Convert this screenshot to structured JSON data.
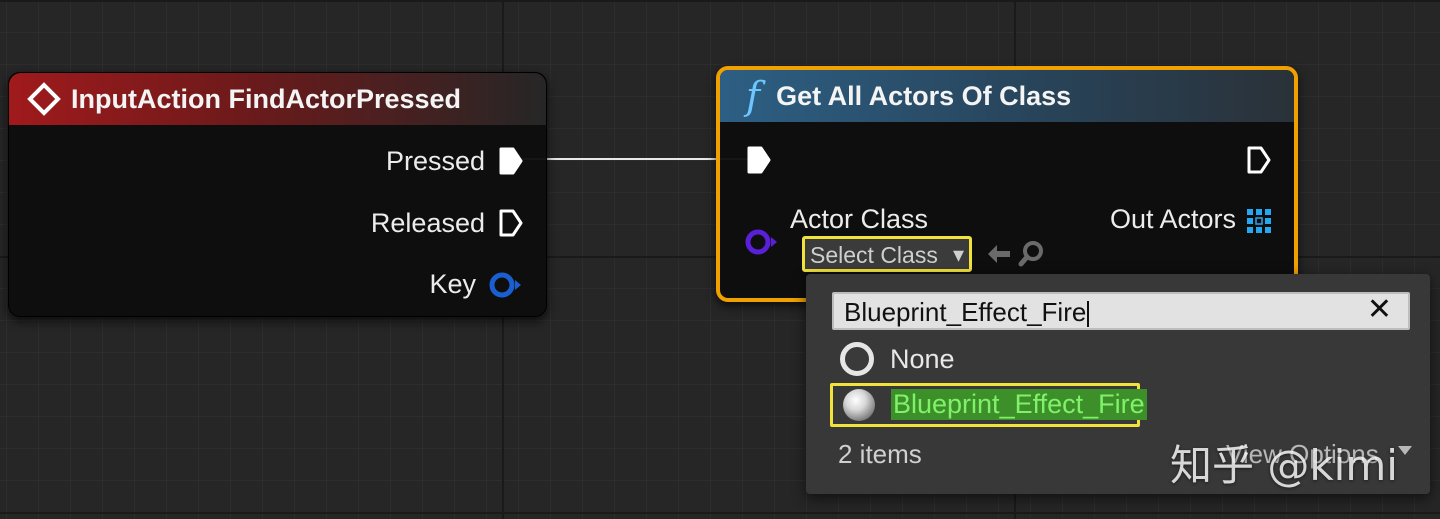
{
  "nodes": {
    "input_action": {
      "title": "InputAction FindActorPressed",
      "pins": {
        "pressed": "Pressed",
        "released": "Released",
        "key": "Key"
      }
    },
    "get_all_actors": {
      "icon_glyph": "f",
      "title": "Get All Actors Of Class",
      "pins": {
        "actor_class": "Actor Class",
        "out_actors": "Out Actors"
      },
      "class_select": {
        "label": "Select Class",
        "arrow": "▾"
      }
    }
  },
  "class_picker": {
    "search": {
      "value": "Blueprint_Effect_Fire",
      "clear_glyph": "✕"
    },
    "items": [
      {
        "label": "None",
        "selected": false
      },
      {
        "label": "Blueprint_Effect_Fire",
        "selected": true
      }
    ],
    "count": "2 items",
    "view_options": "View Options"
  },
  "watermark": "知乎 @kimi",
  "colors": {
    "input_header": "#a01a1c",
    "function_header": "#2d5f84",
    "selection_border": "#f0a100",
    "highlight_border": "#f2e23c",
    "match_highlight": "#4a9b2e",
    "class_pin": "#5a1fd8",
    "key_pin": "#1a5fd0",
    "array_pin": "#26a7f2"
  },
  "icons": [
    "input-action-icon",
    "function-icon",
    "exec-pin-icon",
    "object-pin-icon",
    "struct-pin-icon",
    "array-grid-icon",
    "use-selected-icon",
    "browse-icon",
    "close-icon",
    "radio-icon"
  ]
}
